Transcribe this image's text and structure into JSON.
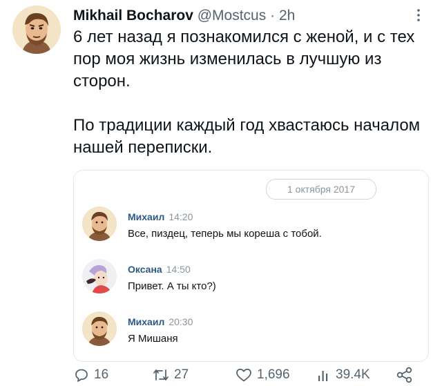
{
  "tweet": {
    "author_name": "Mikhail Bocharov",
    "handle": "@Mostcus",
    "separator": "·",
    "time": "2h",
    "paragraphs": [
      "6 лет назад я познакомился с женой, и с тех пор моя жизнь изменилась в лучшую из сторон.",
      "По традиции каждый год хвастаюсь началом нашей переписки."
    ]
  },
  "chat": {
    "date": "1 октября 2017",
    "messages": [
      {
        "name": "Михаил",
        "time": "14:20",
        "text": "Все, пиздец, теперь мы кореша с тобой."
      },
      {
        "name": "Оксана",
        "time": "14:50",
        "text": "Привет. А ты кто?)"
      },
      {
        "name": "Михаил",
        "time": "20:30",
        "text": "Я Мишаня"
      }
    ]
  },
  "actions": {
    "replies": "16",
    "retweets": "27",
    "likes": "1,696",
    "views": "39.4K"
  },
  "icons": {
    "more": "more-vertical-icon",
    "reply": "reply-icon",
    "retweet": "retweet-icon",
    "like": "heart-icon",
    "views": "views-icon",
    "share": "share-icon"
  },
  "colors": {
    "text": "#0f1419",
    "secondary": "#536471",
    "chat_name": "#2a5885"
  }
}
